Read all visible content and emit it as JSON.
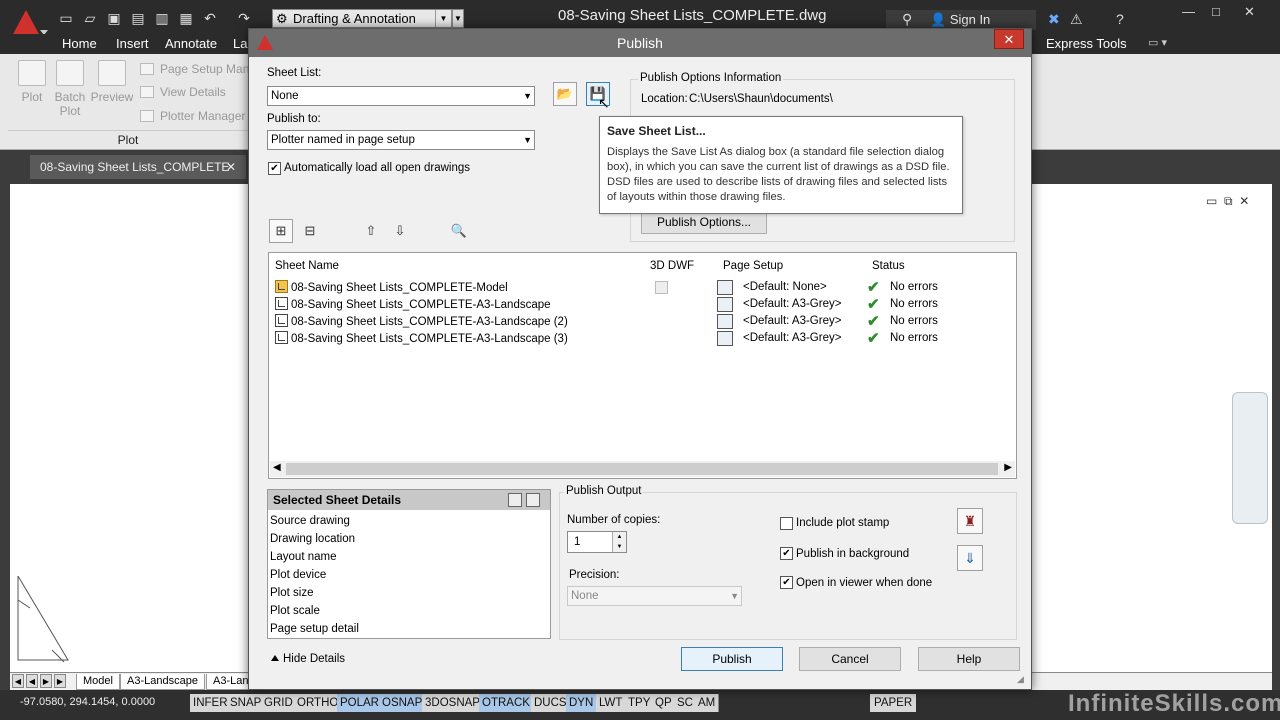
{
  "app": {
    "doc_title": "08-Saving Sheet Lists_COMPLETE.dwg",
    "workspace": "Drafting & Annotation",
    "sign_in": "Sign In",
    "ribbon_tabs": [
      "Home",
      "Insert",
      "Annotate",
      "La",
      "Express Tools"
    ],
    "ribbon": {
      "plot_label": "Plot",
      "batch_plot_label": "Batch\nPlot",
      "preview_label": "Preview",
      "page_setup_manager": "Page Setup Man",
      "view_details": "View Details",
      "plotter_manager": "Plotter Manager",
      "panel_label": "Plot"
    },
    "file_tab": "08-Saving Sheet Lists_COMPLETE",
    "layout_tabs": [
      "Model",
      "A3-Landscape",
      "A3-Lan"
    ],
    "coords": "-97.0580, 294.1454, 0.0000",
    "status_buttons": [
      {
        "label": "INFER",
        "on": false
      },
      {
        "label": "SNAP",
        "on": false
      },
      {
        "label": "GRID",
        "on": false
      },
      {
        "label": "ORTHO",
        "on": false
      },
      {
        "label": "POLAR",
        "on": true
      },
      {
        "label": "OSNAP",
        "on": true
      },
      {
        "label": "3DOSNAP",
        "on": false
      },
      {
        "label": "OTRACK",
        "on": true
      },
      {
        "label": "DUCS",
        "on": false
      },
      {
        "label": "DYN",
        "on": true
      },
      {
        "label": "LWT",
        "on": false
      },
      {
        "label": "TPY",
        "on": false
      },
      {
        "label": "QP",
        "on": false
      },
      {
        "label": "SC",
        "on": false
      },
      {
        "label": "AM",
        "on": false
      }
    ],
    "paper_label": "PAPER",
    "watermark": "InfiniteSkills.com"
  },
  "dialog": {
    "title": "Publish",
    "close_label": "✕",
    "sheet_list_label": "Sheet List:",
    "sheet_list_value": "None",
    "publish_to_label": "Publish to:",
    "publish_to_value": "Plotter named in page setup",
    "auto_load_label": "Automatically load all open drawings",
    "auto_load_checked": true,
    "pub_options_info_label": "Publish Options Information",
    "location_label": "Location:",
    "location_value": "C:\\Users\\Shaun\\documents\\",
    "publish_options_button": "Publish Options...",
    "tooltip": {
      "title": "Save Sheet List...",
      "text": "Displays the Save List As dialog box (a standard file selection dialog box), in which you can save the current list of drawings as a DSD file. DSD files are used to describe lists of drawing files and selected lists of layouts within those drawing files."
    },
    "table": {
      "headers": {
        "name": "Sheet Name",
        "dwf": "3D DWF",
        "page_setup": "Page Setup",
        "status": "Status"
      },
      "rows": [
        {
          "name": "08-Saving Sheet Lists_COMPLETE-Model",
          "model": true,
          "page_setup": "<Default: None>",
          "status": "No errors"
        },
        {
          "name": "08-Saving Sheet Lists_COMPLETE-A3-Landscape",
          "model": false,
          "page_setup": "<Default: A3-Grey>",
          "status": "No errors"
        },
        {
          "name": "08-Saving Sheet Lists_COMPLETE-A3-Landscape (2)",
          "model": false,
          "page_setup": "<Default: A3-Grey>",
          "status": "No errors"
        },
        {
          "name": "08-Saving Sheet Lists_COMPLETE-A3-Landscape (3)",
          "model": false,
          "page_setup": "<Default: A3-Grey>",
          "status": "No errors"
        }
      ]
    },
    "details": {
      "header": "Selected Sheet Details",
      "rows": [
        "Source drawing",
        "Drawing location",
        "Layout name",
        "Plot device",
        "Plot size",
        "Plot scale",
        "Page setup detail"
      ]
    },
    "output": {
      "label": "Publish Output",
      "copies_label": "Number of copies:",
      "copies_value": "1",
      "precision_label": "Precision:",
      "precision_value": "None",
      "plot_stamp_label": "Include plot stamp",
      "plot_stamp_checked": false,
      "background_label": "Publish in background",
      "background_checked": true,
      "viewer_label": "Open in viewer when done",
      "viewer_checked": true
    },
    "hide_details_label": "Hide Details",
    "publish_button": "Publish",
    "cancel_button": "Cancel",
    "help_button": "Help"
  }
}
